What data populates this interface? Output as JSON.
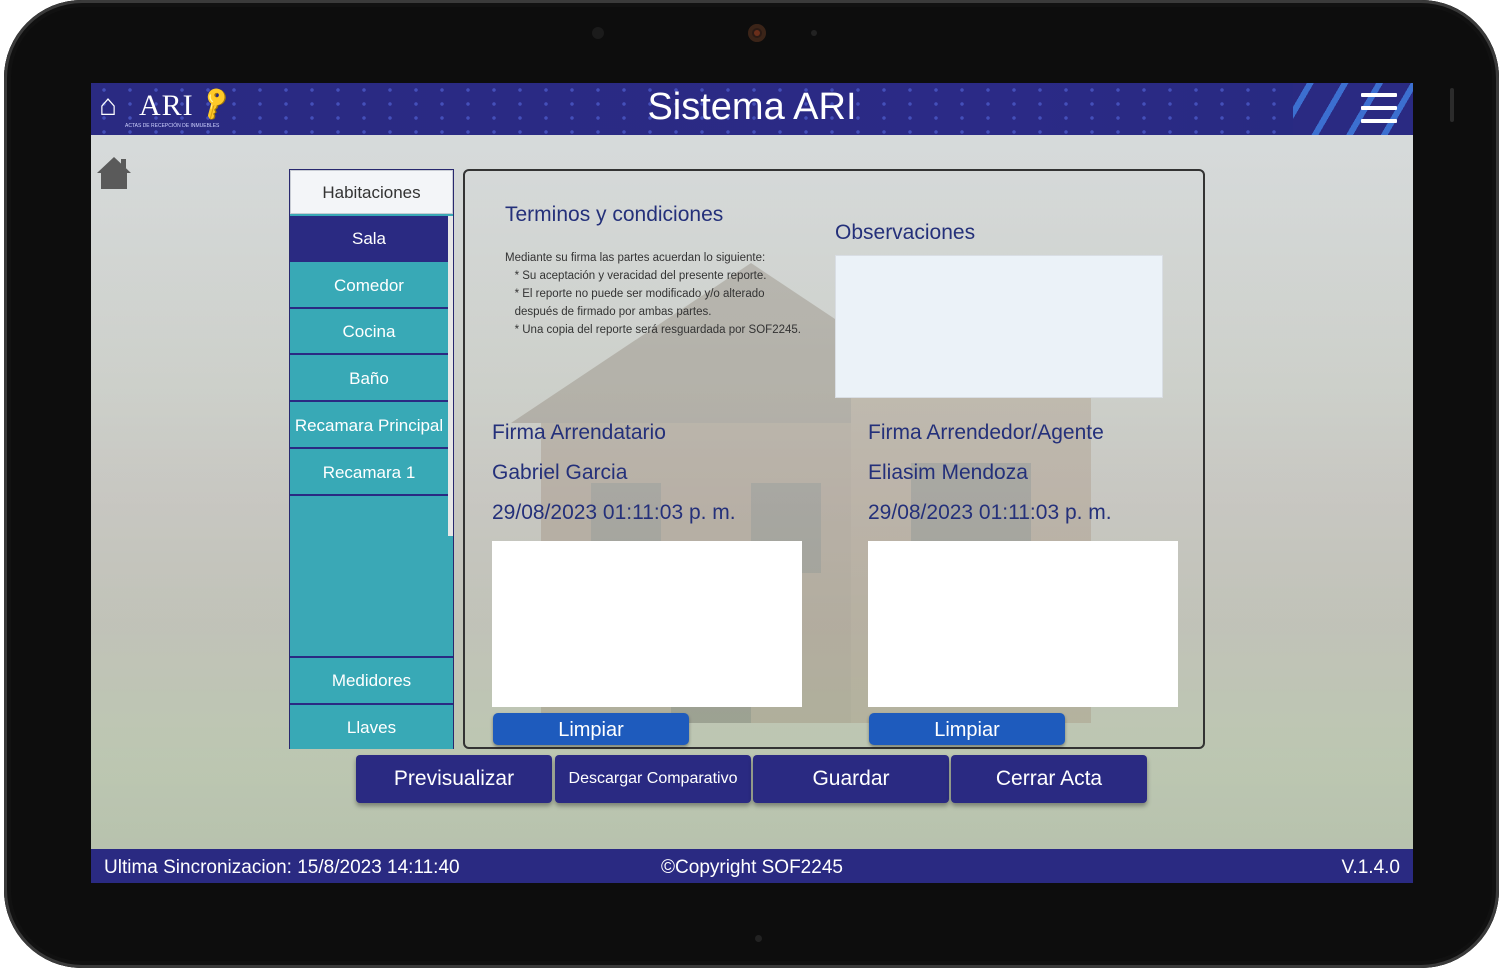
{
  "header": {
    "logo_text": "ARI",
    "logo_subtitle": "ACTAS DE RECEPCIÓN DE INMUEBLES",
    "title": "Sistema ARI"
  },
  "rooms": {
    "header": "Habitaciones",
    "items": [
      "Sala",
      "Comedor",
      "Cocina",
      "Baño",
      "Recamara Principal",
      "Recamara 1"
    ],
    "active": "Sala",
    "bottom": [
      "Medidores",
      "Llaves"
    ]
  },
  "terms": {
    "title": "Terminos y condiciones",
    "body": "Mediante su firma las partes acuerdan lo siguiente:\n   * Su aceptación y veracidad del presente reporte.\n   * El reporte no puede ser modificado y/o alterado\n   después de firmado por ambas partes.\n   * Una copia del reporte será resguardada por SOF2245."
  },
  "observations": {
    "title": "Observaciones",
    "value": ""
  },
  "tenant_signature": {
    "title": "Firma Arrendatario",
    "name": "Gabriel Garcia",
    "date": "29/08/2023 01:11:03 p. m.",
    "clear_label": "Limpiar"
  },
  "landlord_signature": {
    "title": "Firma Arrendedor/Agente",
    "name": "Eliasim Mendoza",
    "date": "29/08/2023 01:11:03 p. m.",
    "clear_label": "Limpiar"
  },
  "actions": {
    "preview": "Previsualizar",
    "download": "Descargar Comparativo",
    "save": "Guardar",
    "close": "Cerrar Acta"
  },
  "footer": {
    "last_sync": "Ultima Sincronizacion: 15/8/2023 14:11:40",
    "copyright": "©Copyright SOF2245",
    "version": "V.1.4.0"
  },
  "colors": {
    "primary": "#2a2a82",
    "teal": "#38a9b6",
    "button_blue": "#1e5bbd",
    "title_text": "#24307a"
  }
}
